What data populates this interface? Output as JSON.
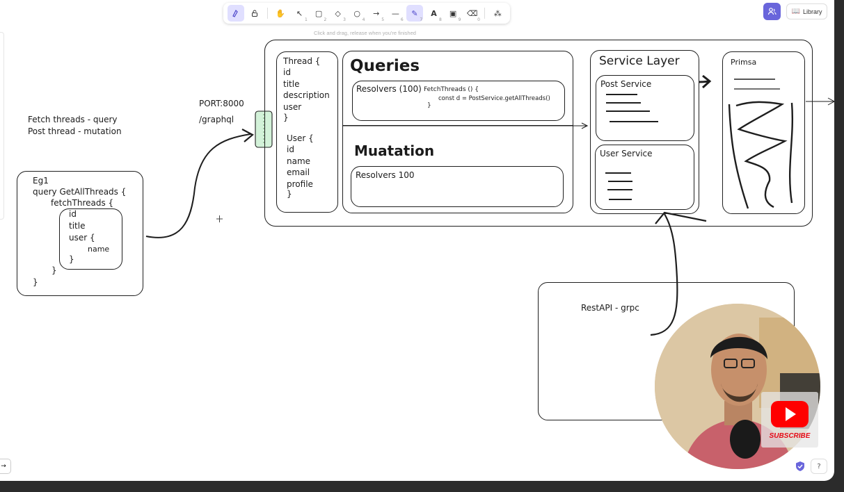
{
  "toolbar": {
    "tools": [
      {
        "name": "lock",
        "glyph": "🔓"
      },
      {
        "name": "hand",
        "glyph": "✋",
        "key": ""
      },
      {
        "name": "selection",
        "glyph": "↖",
        "key": "1"
      },
      {
        "name": "rectangle",
        "glyph": "▢",
        "key": "2"
      },
      {
        "name": "diamond",
        "glyph": "◇",
        "key": "3"
      },
      {
        "name": "ellipse",
        "glyph": "○",
        "key": "4"
      },
      {
        "name": "arrow",
        "glyph": "→",
        "key": "5"
      },
      {
        "name": "line",
        "glyph": "—",
        "key": "6"
      },
      {
        "name": "draw",
        "glyph": "✎",
        "key": "7"
      },
      {
        "name": "text",
        "glyph": "A",
        "key": "8"
      },
      {
        "name": "image",
        "glyph": "▣",
        "key": "9"
      },
      {
        "name": "eraser",
        "glyph": "⌫",
        "key": "0"
      },
      {
        "name": "more",
        "glyph": "⁂",
        "key": ""
      }
    ],
    "hint": "Click and drag, release when you're finished"
  },
  "header": {
    "library_label": "Library"
  },
  "canvas": {
    "left_notes": [
      "Fetch threads - query",
      "Post thread - mutation"
    ],
    "port_label": "PORT:8000",
    "endpoint_label": "/graphql",
    "eg_box": {
      "title": "Eg1",
      "lines": [
        "query GetAllThreads {",
        "fetchThreads {"
      ],
      "inner": [
        "id",
        "title",
        "user {",
        "name",
        "}"
      ],
      "closing": [
        "}",
        "}"
      ]
    },
    "schema_box": {
      "thread": [
        "Thread {",
        "id",
        "title",
        "description",
        "user",
        "}"
      ],
      "user": [
        "User {",
        "id",
        "name",
        "email",
        "profile",
        "}"
      ]
    },
    "queries_box": {
      "title": "Queries",
      "resolver_label": "Resolvers (100)",
      "code": [
        "FetchThreads () {",
        "const d = PostService.getAllThreads()",
        "}"
      ]
    },
    "mutation_box": {
      "title": "Muatation",
      "resolver_label": "Resolvers 100"
    },
    "service_layer": {
      "title": "Service Layer",
      "post_service": "Post Service",
      "user_service": "User Service"
    },
    "prisma_label": "Primsa",
    "rest_label": "RestAPI - grpc"
  },
  "overlay": {
    "subscribe_label": "SUBSCRIBE"
  },
  "colors": {
    "accent": "#6965db",
    "selected_tool": "#e0dfff",
    "endpoint_fill": "#d3f2d9",
    "youtube_red": "#ff0000"
  }
}
